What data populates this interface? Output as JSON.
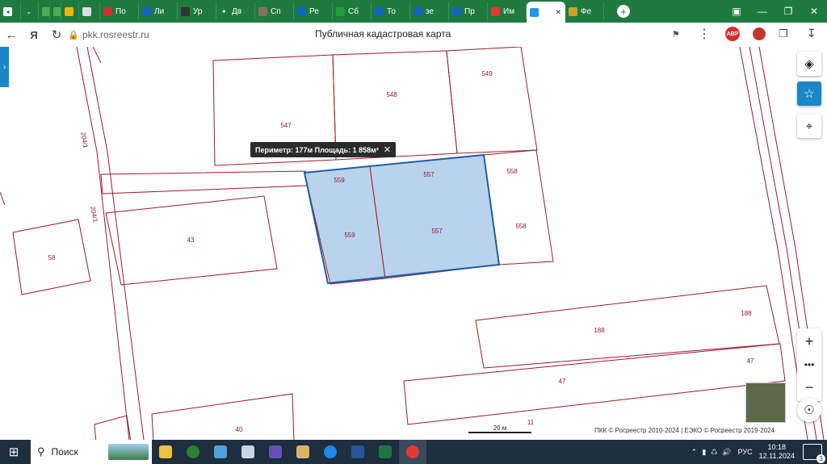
{
  "tabs": [
    {
      "label": "",
      "icon": "speaker-icon",
      "color": "#ffffff"
    },
    {
      "label": "",
      "icon": "chevron-down-icon",
      "color": "#ffffff"
    },
    {
      "label": "",
      "icon": "app-icon",
      "color": "#4caf50"
    },
    {
      "label": "",
      "icon": "app-icon",
      "color": "#4caf50"
    },
    {
      "label": "",
      "icon": "mail-icon",
      "color": "#f4b400"
    },
    {
      "label": "",
      "icon": "volume-icon",
      "color": "#dddddd"
    },
    {
      "label": "По",
      "icon": "flag-icon",
      "color": "#d32f2f"
    },
    {
      "label": "Ли",
      "icon": "globe-icon",
      "color": "#1565c0"
    },
    {
      "label": "Ур",
      "icon": "bank-icon",
      "color": "#333333"
    },
    {
      "label": "Дв",
      "icon": "plus-icon",
      "color": "#ffffff"
    },
    {
      "label": "Сп",
      "icon": "building-icon",
      "color": "#8d6e63"
    },
    {
      "label": "Ре",
      "icon": "globe-icon",
      "color": "#1565c0"
    },
    {
      "label": "Сб",
      "icon": "sber-icon",
      "color": "#21a038"
    },
    {
      "label": "То",
      "icon": "globe-icon",
      "color": "#1565c0"
    },
    {
      "label": "зе",
      "icon": "globe-icon",
      "color": "#1565c0"
    },
    {
      "label": "Пр",
      "icon": "globe-icon",
      "color": "#1565c0"
    },
    {
      "label": "Им",
      "icon": "rts-icon",
      "color": "#e53935"
    },
    {
      "label": "",
      "icon": "map-icon",
      "color": "#2196f3",
      "active": true
    },
    {
      "label": "Фе",
      "icon": "emblem-icon",
      "color": "#c9a227"
    }
  ],
  "address": {
    "url": "pkk.rosreestr.ru",
    "title": "Публичная кадастровая карта",
    "ext_badge": "ABP"
  },
  "map": {
    "tooltip": "Периметр: 177м Площадь: 1 858м²",
    "selection_fill": "#b9d3ec",
    "selection_stroke": "#1f5fa0",
    "boundary_color": "#9b1b2b",
    "parcel_labels": [
      {
        "text": "547"
      },
      {
        "text": "548"
      },
      {
        "text": "549"
      },
      {
        "text": "559"
      },
      {
        "text": "557"
      },
      {
        "text": "558"
      },
      {
        "text": "559"
      },
      {
        "text": "557"
      },
      {
        "text": "558"
      },
      {
        "text": "43"
      },
      {
        "text": "58"
      },
      {
        "text": "188"
      },
      {
        "text": "188"
      },
      {
        "text": "47"
      },
      {
        "text": "47"
      },
      {
        "text": "40"
      },
      {
        "text": "11"
      },
      {
        "text": "204/1"
      },
      {
        "text": "204/1"
      }
    ],
    "scale": "20 м",
    "copyright": "ПКК © Росреестр 2010-2024 | ЕЭКО © Росреестр 2019-2024"
  },
  "taskbar": {
    "search_placeholder": "Поиск",
    "lang": "РУС",
    "time": "10:18",
    "date": "12.11.2024",
    "notifications": "3"
  }
}
